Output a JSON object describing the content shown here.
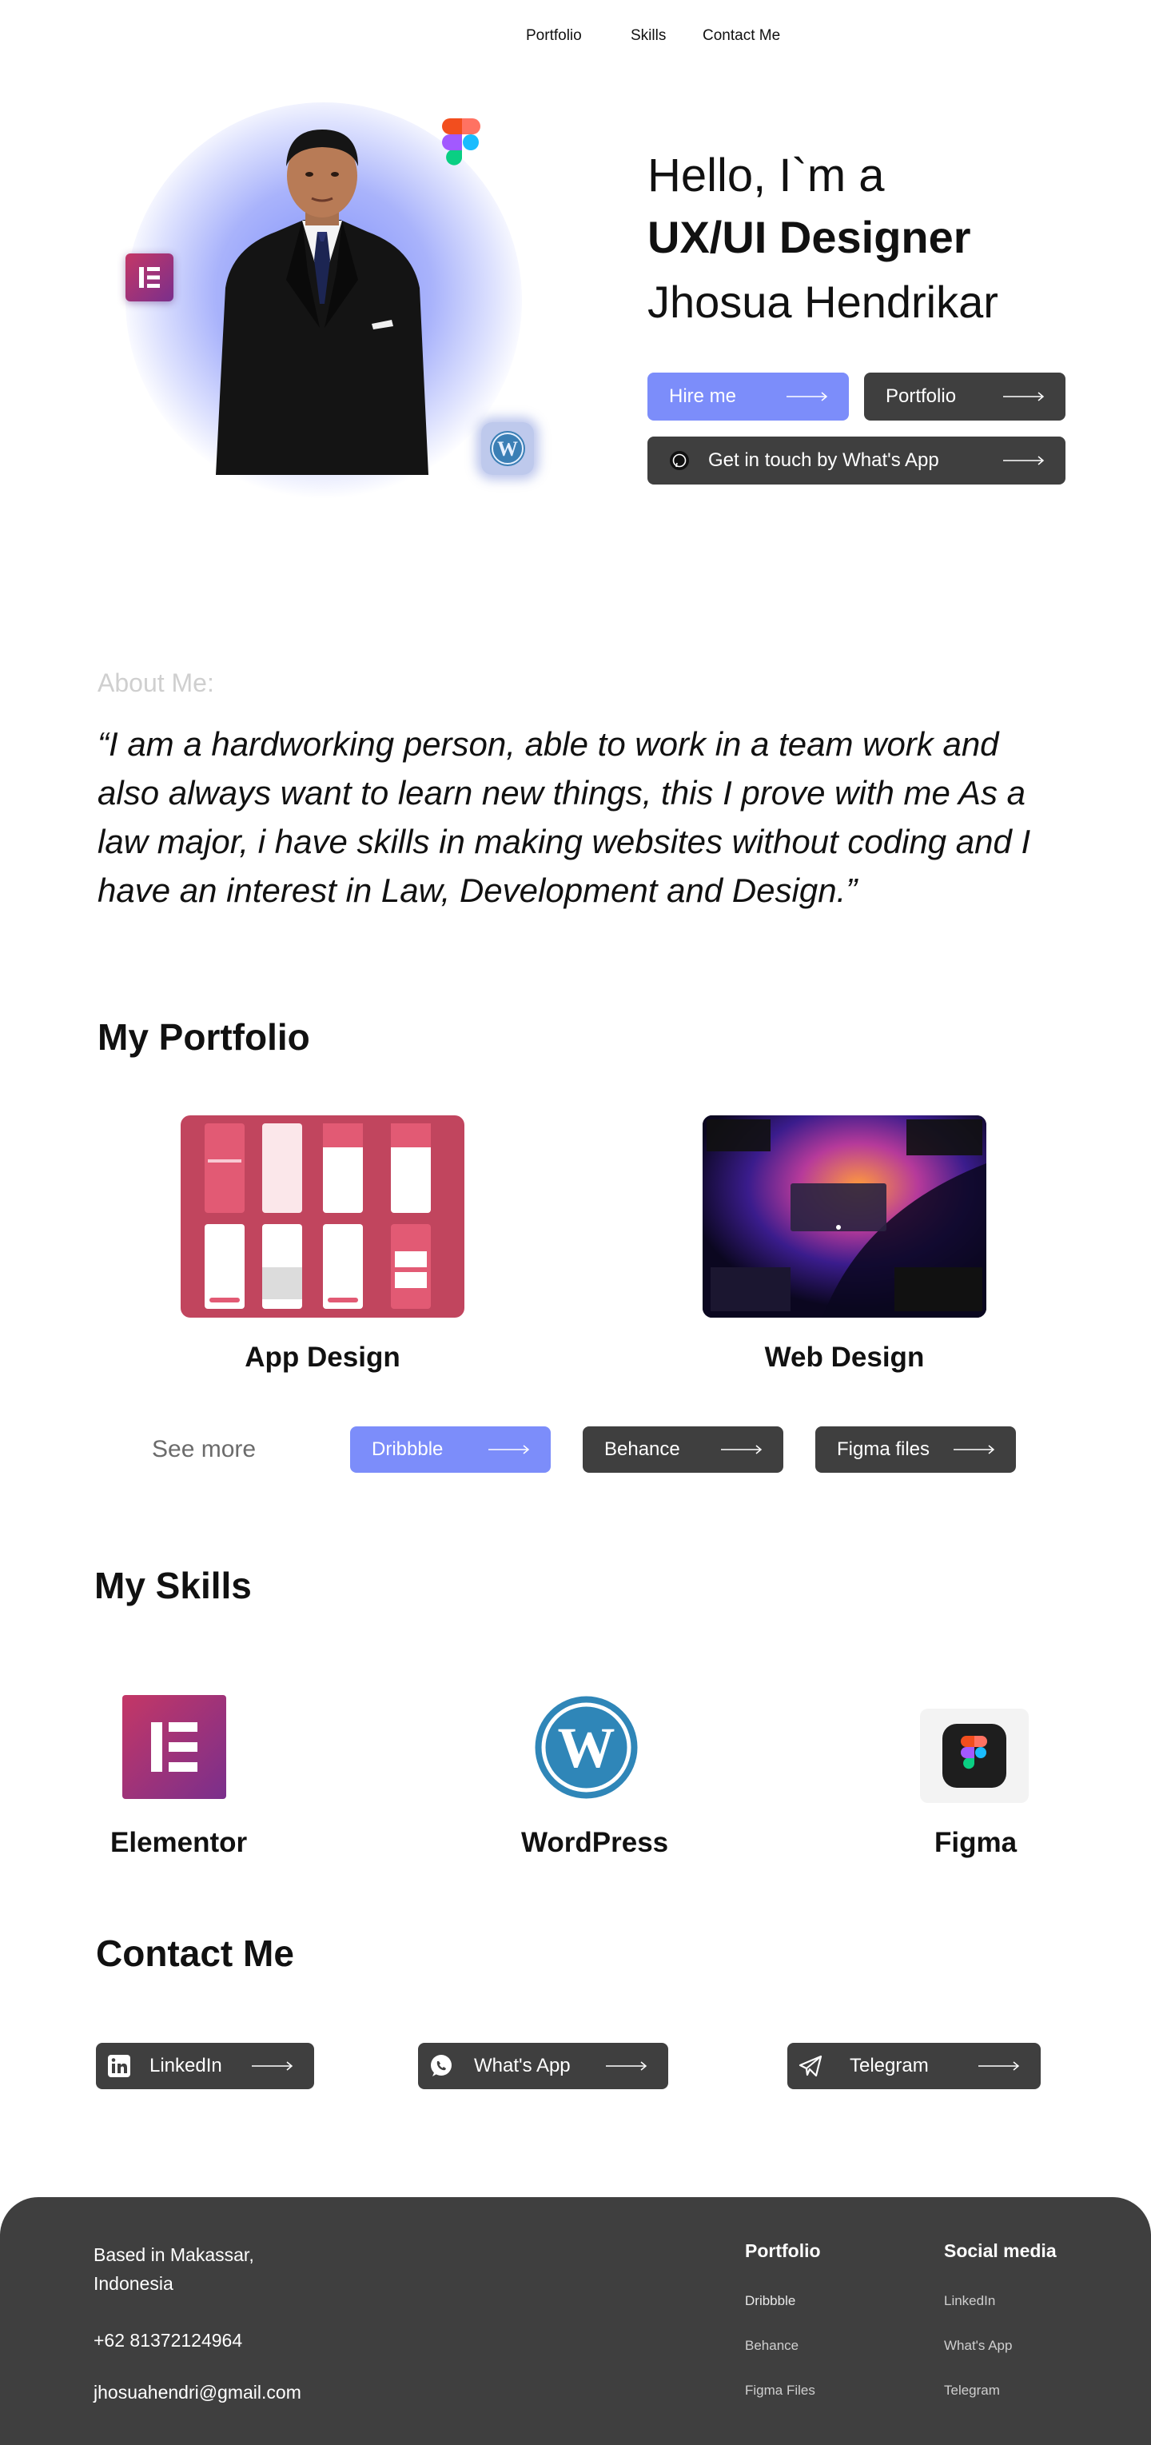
{
  "nav": {
    "items": [
      "Portfolio",
      "Skills",
      "Contact Me"
    ]
  },
  "hero": {
    "greeting": "Hello, I`m a",
    "role": "UX/UI Designer",
    "name": "Jhosua Hendrikar",
    "buttons": {
      "hire": "Hire me",
      "portfolio": "Portfolio",
      "whatsapp": "Get in touch by What's App"
    },
    "icons": [
      "elementor-icon",
      "figma-icon",
      "wordpress-icon"
    ]
  },
  "about": {
    "label": "About Me:",
    "text": "“I am a hardworking person, able to work in a team work and also always want to learn new things, this I prove with me As a law major, i have skills in making websites without coding and I have an interest in Law, Development and Design.”"
  },
  "portfolio": {
    "title": "My Portfolio",
    "cards": [
      {
        "caption": "App Design"
      },
      {
        "caption": "Web Design"
      }
    ],
    "see_more": "See more",
    "links": [
      "Dribbble",
      "Behance",
      "Figma files"
    ]
  },
  "skills": {
    "title": "My Skills",
    "items": [
      "Elementor",
      "WordPress",
      "Figma"
    ]
  },
  "contact": {
    "title": "Contact Me",
    "links": [
      "LinkedIn",
      "What's App",
      "Telegram"
    ]
  },
  "footer": {
    "address": "Based in Makassar, Indonesia",
    "phone": "+62 81372124964",
    "email": "jhosuahendri@gmail.com",
    "portfolio_heading": "Portfolio",
    "portfolio_links": [
      "Dribbble",
      "Behance",
      "Figma Files"
    ],
    "social_heading": "Social media",
    "social_links": [
      "LinkedIn",
      "What's App",
      "Telegram"
    ]
  },
  "colors": {
    "accent": "#7c8dfa",
    "dark_button": "#3f3f3f",
    "footer_bg": "#3f3f3f"
  }
}
